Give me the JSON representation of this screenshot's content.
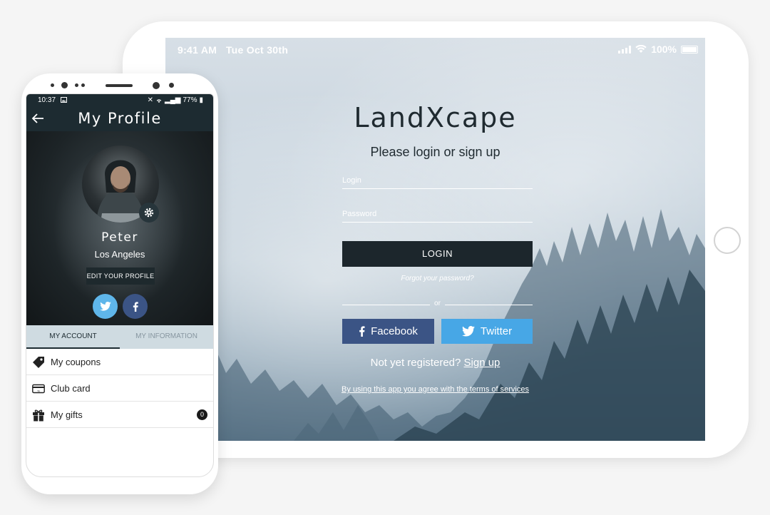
{
  "tablet": {
    "status": {
      "time": "9:41 AM",
      "date": "Tue Oct 30th",
      "battery": "100%"
    },
    "logo": "LandXcape",
    "subtitle": "Please login or sign up",
    "login_placeholder": "Login",
    "password_placeholder": "Password",
    "login_button": "LOGIN",
    "forgot_link": "Forgot your password?",
    "or_label": "or",
    "facebook_button": "Facebook",
    "twitter_button": "Twitter",
    "register_prompt": "Not yet registered?",
    "signup_link": "Sign up",
    "terms_link": "By using this app you agree with the terms of services"
  },
  "phone": {
    "status": {
      "time": "10:37",
      "battery": "77%"
    },
    "title": "My Profile",
    "profile": {
      "name": "Peter",
      "city": "Los Angeles",
      "edit_button": "EDIT YOUR PROFILE"
    },
    "tabs": [
      {
        "label": "MY ACCOUNT",
        "active": true
      },
      {
        "label": "MY INFORMATION",
        "active": false
      }
    ],
    "menu": [
      {
        "label": "My coupons",
        "icon": "tag-icon"
      },
      {
        "label": "Club card",
        "icon": "card-icon"
      },
      {
        "label": "My gifts",
        "icon": "gift-icon",
        "badge": "0"
      }
    ]
  },
  "colors": {
    "dark": "#1d2b31",
    "facebook": "#3b5485",
    "twitter": "#47a7e6",
    "tab_bar": "#cfdbe1"
  }
}
